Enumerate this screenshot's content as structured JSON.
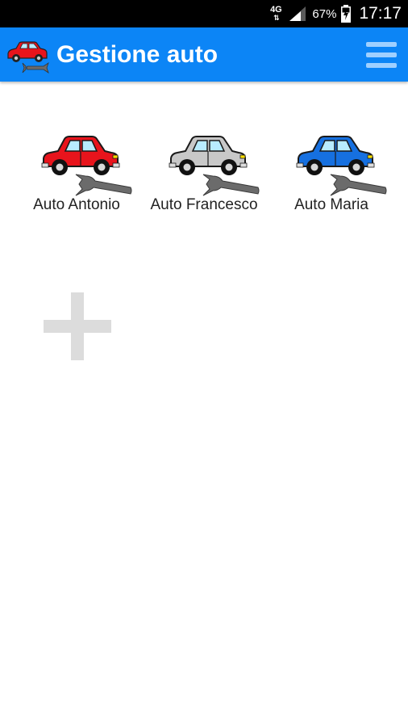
{
  "status_bar": {
    "network": "4G",
    "battery": "67%",
    "time": "17:17",
    "icons": [
      "network-4g-icon",
      "signal-icon",
      "battery-icon"
    ]
  },
  "app_bar": {
    "title": "Gestione auto",
    "color": "#0c85f6",
    "logo_icon": "car-wrench-icon",
    "menu_icon": "hamburger-menu-icon"
  },
  "cars": [
    {
      "label": "Auto Antonio",
      "color": "#e8141c"
    },
    {
      "label": "Auto Francesco",
      "color": "#c8c8c8"
    },
    {
      "label": "Auto Maria",
      "color": "#1670e0"
    }
  ],
  "add_button": {
    "icon": "plus-icon",
    "color": "#dcdcdc"
  }
}
